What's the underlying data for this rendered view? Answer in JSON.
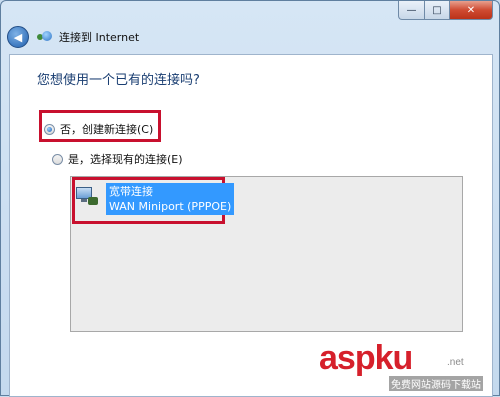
{
  "window": {
    "title": "连接到 Internet",
    "caption_buttons": {
      "minimize": "—",
      "maximize": "□",
      "close": "✕"
    }
  },
  "content": {
    "question": "您想使用一个已有的连接吗?",
    "options": [
      {
        "label": "否，创建新连接(C)",
        "checked": true
      },
      {
        "label": "是，选择现有的连接(E)",
        "checked": false
      }
    ],
    "connections": [
      {
        "name": "宽带连接",
        "device": "WAN Miniport (PPPOE)",
        "selected": true
      }
    ]
  },
  "watermark": {
    "main": "aspku",
    "net": ".net",
    "sub": "免费网站源码下载站"
  },
  "colors": {
    "highlight_border": "#c8102e",
    "selection": "#3399ff",
    "question_text": "#1a3e72"
  }
}
